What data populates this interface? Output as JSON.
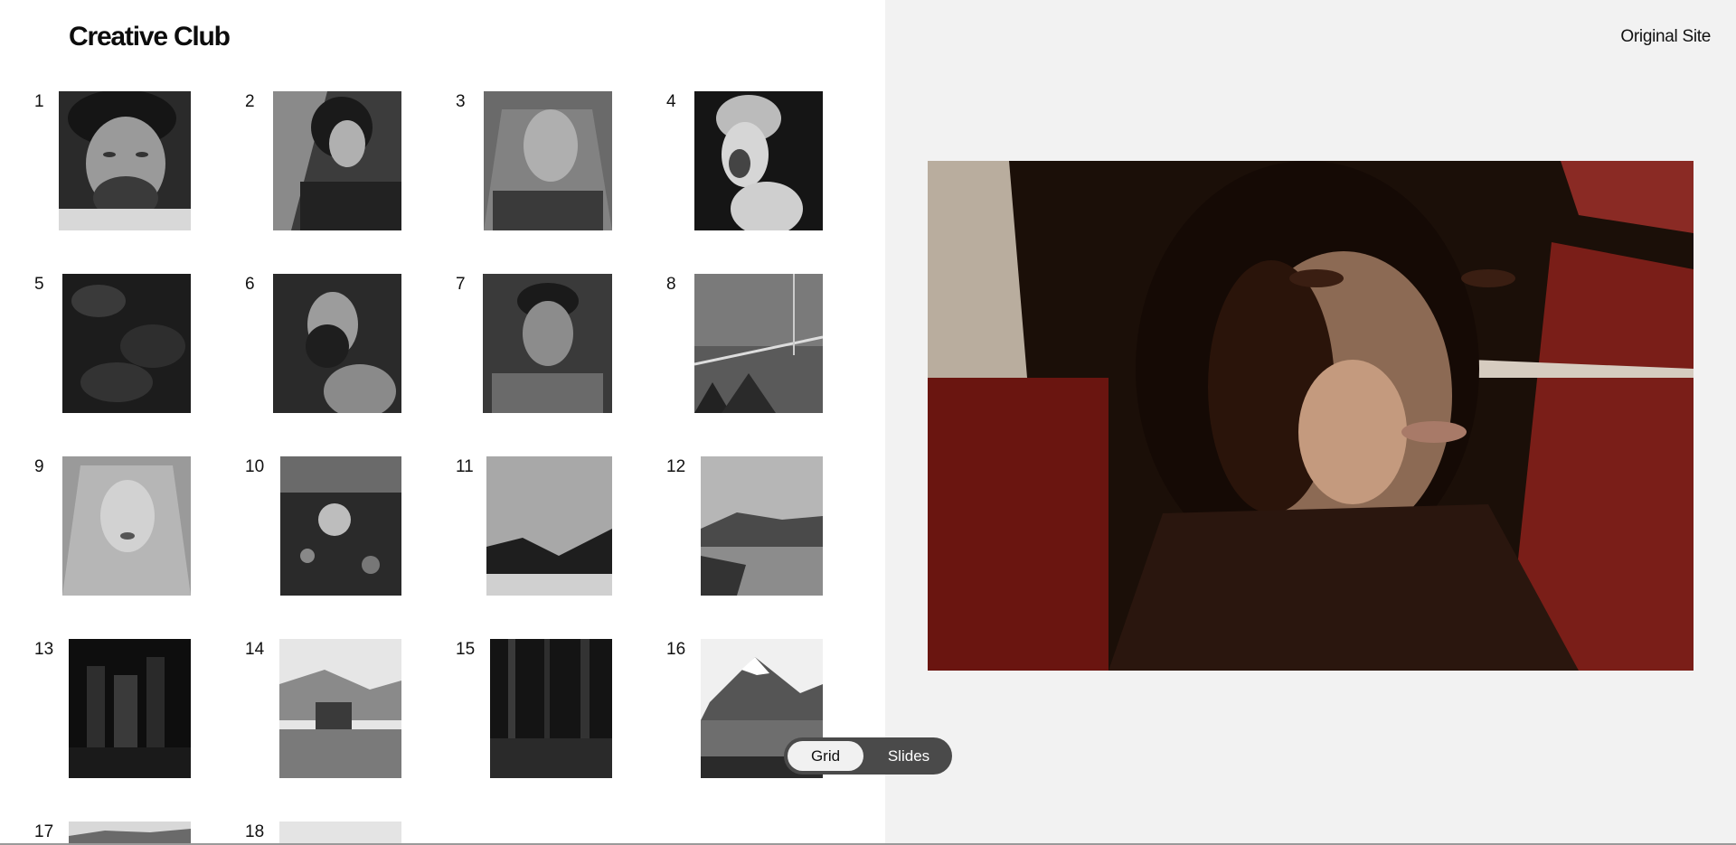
{
  "header": {
    "brand": "Creative Club",
    "original_site_link": "Original Site"
  },
  "gallery": {
    "items": [
      {
        "number": "1",
        "subject": "portrait of man with curly hair and beard"
      },
      {
        "number": "2",
        "subject": "woman with bob haircut in shadow"
      },
      {
        "number": "3",
        "subject": "young man with sheer veil"
      },
      {
        "number": "4",
        "subject": "painted face with curly hair"
      },
      {
        "number": "5",
        "subject": "dark abstract texture"
      },
      {
        "number": "6",
        "subject": "bearded man in profile"
      },
      {
        "number": "7",
        "subject": "man in hooded jacket"
      },
      {
        "number": "8",
        "subject": "bridge over misty water"
      },
      {
        "number": "9",
        "subject": "woman with veil"
      },
      {
        "number": "10",
        "subject": "hand holding flower"
      },
      {
        "number": "11",
        "subject": "hanging foliage over rocks"
      },
      {
        "number": "12",
        "subject": "lake and hills landscape"
      },
      {
        "number": "13",
        "subject": "city skyline at night"
      },
      {
        "number": "14",
        "subject": "house among trees with mountains"
      },
      {
        "number": "15",
        "subject": "dark forest"
      },
      {
        "number": "16",
        "subject": "snowy mountain over lake"
      },
      {
        "number": "17",
        "subject": "hills"
      },
      {
        "number": "18",
        "subject": "bright sky"
      }
    ]
  },
  "preview": {
    "subject": "woman with bob haircut in red and white light"
  },
  "view_toggle": {
    "grid_label": "Grid",
    "slides_label": "Slides",
    "active": "Grid"
  },
  "colors": {
    "left_bg": "#ffffff",
    "right_bg": "#f2f2f2",
    "toggle_bg": "#4a4a4a",
    "toggle_active": "#f1f1f1"
  }
}
